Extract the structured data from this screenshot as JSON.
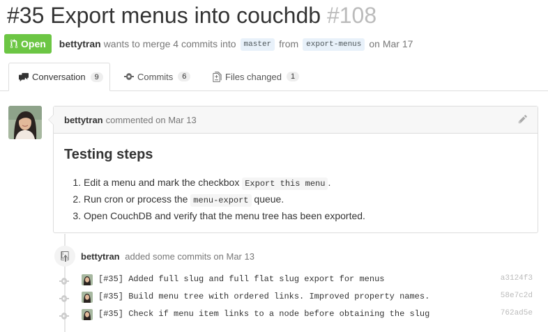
{
  "pr": {
    "title": "#35 Export menus into couchdb",
    "number": "#108",
    "state": "Open",
    "author": "bettytran",
    "merge_text": "wants to merge 4 commits into",
    "base_branch": "master",
    "from_text": "from",
    "head_branch": "export-menus",
    "date_text": "on Mar 17"
  },
  "tabs": [
    {
      "label": "Conversation",
      "count": "9",
      "icon": "comment-discussion-icon"
    },
    {
      "label": "Commits",
      "count": "6",
      "icon": "git-commit-icon"
    },
    {
      "label": "Files changed",
      "count": "1",
      "icon": "diff-icon"
    }
  ],
  "comment": {
    "author": "bettytran",
    "meta": "commented on Mar 13",
    "heading": "Testing steps",
    "steps": [
      {
        "before": "Edit a menu and mark the checkbox",
        "code": "Export this menu",
        "after": "."
      },
      {
        "before": "Run cron or process the",
        "code": "menu-export",
        "after": "queue."
      },
      {
        "before": "Open CouchDB and verify that the menu tree has been exported.",
        "code": "",
        "after": ""
      }
    ]
  },
  "commits_event": {
    "author": "bettytran",
    "text": "added some commits on Mar 13"
  },
  "commits": [
    {
      "message": "[#35] Added full slug and full flat slug export for menus",
      "sha": "a3124f3"
    },
    {
      "message": "[#35] Build menu tree with ordered links. Improved property names.",
      "sha": "58e7c2d"
    },
    {
      "message": "[#35] Check if menu item links to a node before obtaining the slug",
      "sha": "762ad5e"
    }
  ],
  "colors": {
    "open_state": "#6cc644",
    "branch_bg": "#e8f1fa"
  }
}
